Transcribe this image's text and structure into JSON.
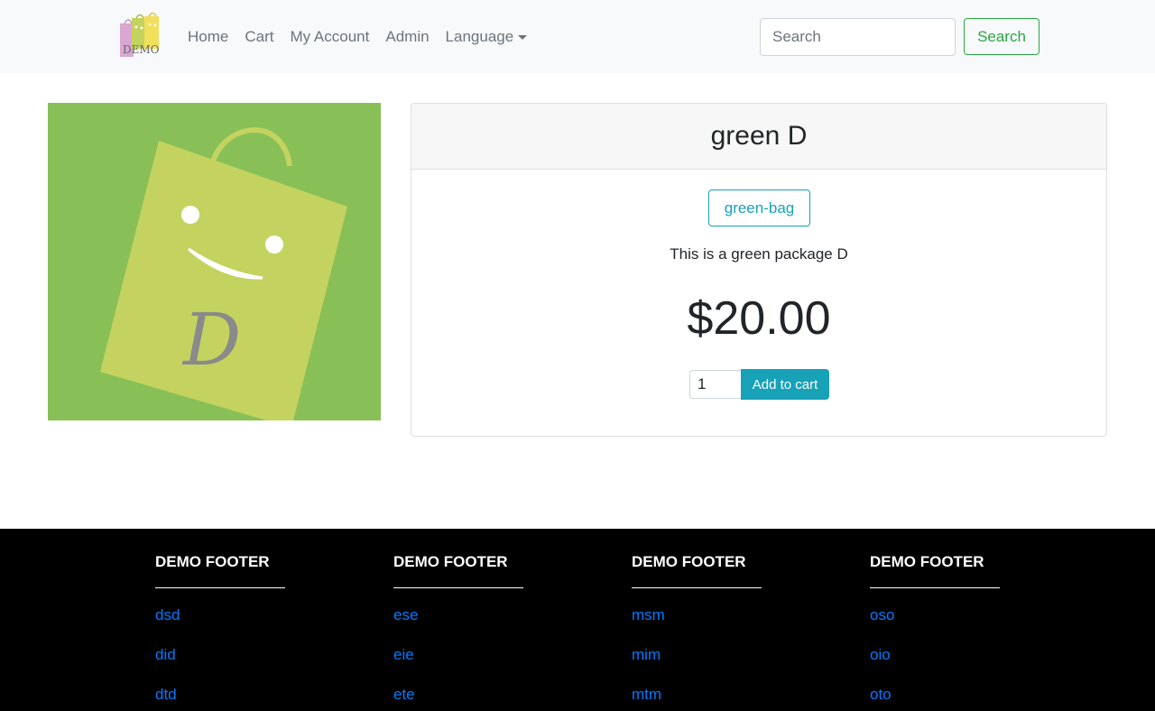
{
  "navbar": {
    "brand_text": "DEMO",
    "links": [
      {
        "label": "Home"
      },
      {
        "label": "Cart"
      },
      {
        "label": "My Account"
      },
      {
        "label": "Admin"
      },
      {
        "label": "Language"
      }
    ],
    "search": {
      "placeholder": "Search",
      "button_label": "Search"
    }
  },
  "product": {
    "image_icon": "green-bag-image",
    "image_letter": "D",
    "title": "green D",
    "tag": "green-bag",
    "description": "This is a green package D",
    "price": "$20.00",
    "quantity": "1",
    "add_to_cart_label": "Add to cart"
  },
  "footer": {
    "columns": [
      {
        "heading": "DEMO FOOTER",
        "links": [
          "dsd",
          "did",
          "dtd"
        ]
      },
      {
        "heading": "DEMO FOOTER",
        "links": [
          "ese",
          "eie",
          "ete"
        ]
      },
      {
        "heading": "DEMO FOOTER",
        "links": [
          "msm",
          "mim",
          "mtm"
        ]
      },
      {
        "heading": "DEMO FOOTER",
        "links": [
          "oso",
          "oio",
          "oto"
        ]
      }
    ]
  },
  "colors": {
    "primary": "#17a2b8",
    "success": "#28a745",
    "link": "#007bff",
    "image_background": "#88c057",
    "bag": "#c4d35f"
  }
}
